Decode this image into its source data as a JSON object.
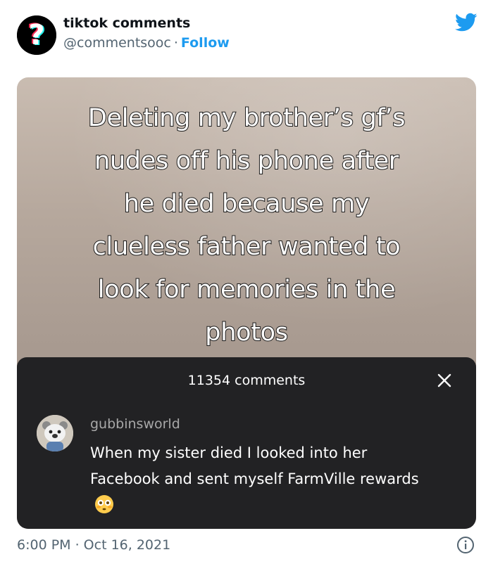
{
  "author": {
    "name": "tiktok comments",
    "handle": "@commentsooc",
    "separator": "·",
    "follow_label": "Follow"
  },
  "icons": {
    "avatar": "question-mark-logo",
    "brand": "twitter-bird-icon",
    "close": "close-icon",
    "info": "info-icon",
    "emoji": "flushed-face-emoji"
  },
  "media": {
    "caption_lines": [
      "Deleting my brother’s gf’s",
      "nudes off his phone after",
      "he died because my",
      "clueless father wanted to",
      "look for memories in the",
      "photos"
    ],
    "comments_count": "11354 comments",
    "comment": {
      "username": "gubbinsworld",
      "text": "When my sister died I looked into her Facebook and sent myself FarmVille rewards"
    }
  },
  "footer": {
    "timestamp": "6:00 PM · Oct 16, 2021"
  },
  "colors": {
    "twitter_blue": "#1d9bf0",
    "panel_bg": "#222224",
    "secondary_text": "#536471"
  }
}
